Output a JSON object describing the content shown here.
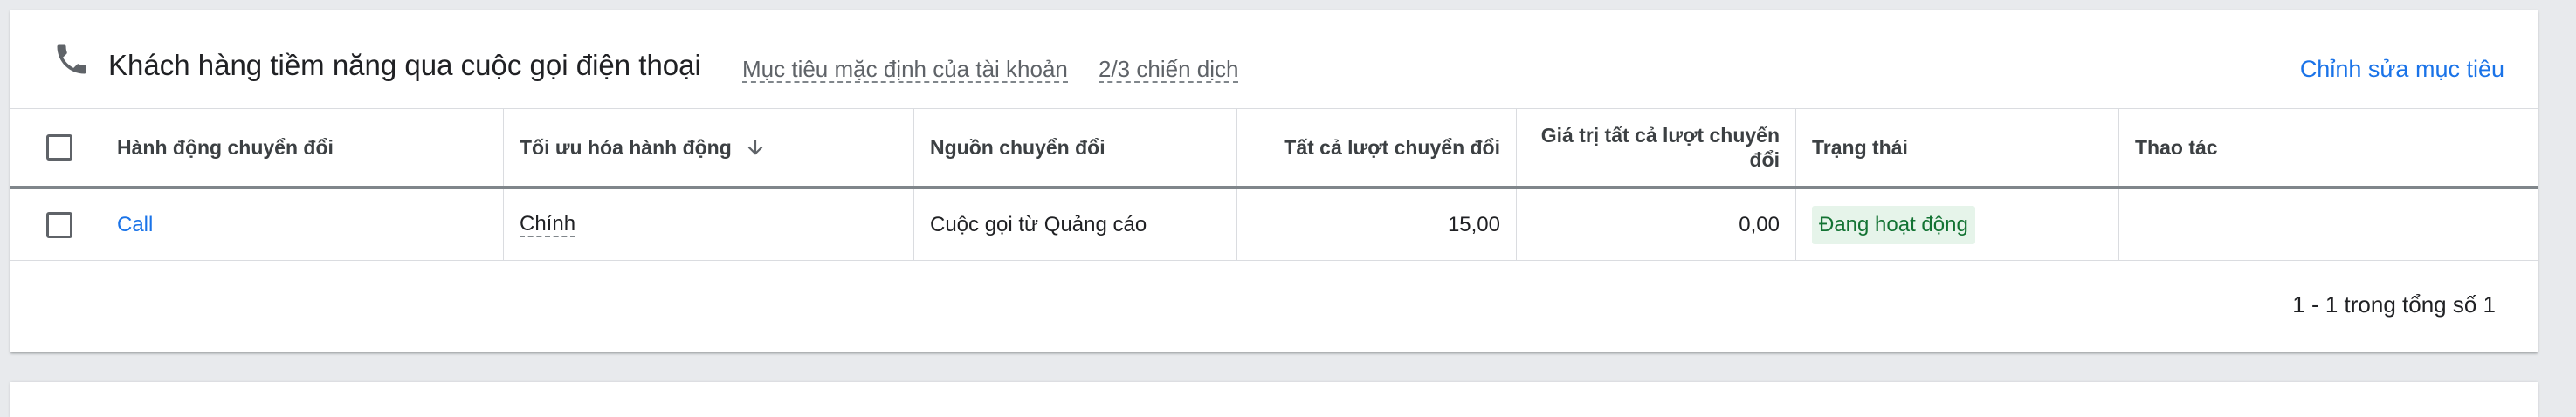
{
  "header": {
    "title": "Khách hàng tiềm năng qua cuộc gọi điện thoại",
    "goal_scope": "Mục tiêu mặc định của tài khoản",
    "campaigns": "2/3 chiến dịch",
    "edit_label": "Chỉnh sửa mục tiêu"
  },
  "table": {
    "columns": {
      "action": "Hành động chuyển đổi",
      "optimization": "Tối ưu hóa hành động",
      "source": "Nguồn chuyển đổi",
      "all_conversions": "Tất cả lượt chuyển đổi",
      "all_conv_value": "Giá trị tất cả lượt chuyển đổi",
      "status": "Trạng thái",
      "actions": "Thao tác"
    },
    "rows": [
      {
        "action": "Call",
        "optimization": "Chính",
        "source": "Cuộc gọi từ Quảng cáo",
        "all_conversions": "15,00",
        "all_conv_value": "0,00",
        "status": "Đang hoạt động",
        "actions": ""
      }
    ]
  },
  "pagination": "1 - 1 trong tổng số 1",
  "colors": {
    "link": "#1a73e8",
    "status_bg": "#e6f4ea",
    "status_text": "#137333"
  }
}
